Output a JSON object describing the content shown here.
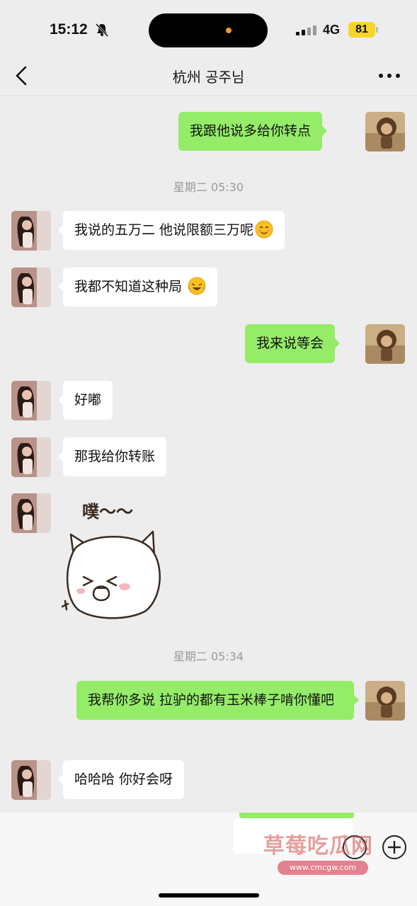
{
  "status_bar": {
    "time": "15:12",
    "network": "4G",
    "battery": "81"
  },
  "header": {
    "title": "杭州 공주님"
  },
  "messages": [
    {
      "side": "out",
      "text": "我跟他说多给你转点"
    },
    {
      "type": "time",
      "text": "星期二 05:30"
    },
    {
      "side": "in",
      "text": "我说的五万二 他说限额三万呢",
      "emoji": "smiling-face-icon"
    },
    {
      "side": "in",
      "text": "我都不知道这种局",
      "emoji": "crying-laughing-face-icon"
    },
    {
      "side": "out",
      "text": "我来说等会"
    },
    {
      "side": "in",
      "text": "好嘟"
    },
    {
      "side": "in",
      "text": "那我给你转账"
    },
    {
      "side": "in",
      "sticker": {
        "caption": "噗～～",
        "icon": "giggling-cat-sticker"
      }
    },
    {
      "type": "time",
      "text": "星期二 05:34"
    },
    {
      "side": "out",
      "text": "我帮你多说 拉驴的都有玉米棒子啃你懂吧"
    },
    {
      "side": "in",
      "text": "哈哈哈 你好会呀"
    }
  ],
  "watermark": {
    "text": "草莓吃瓜网",
    "url": "www.cmcgw.com"
  },
  "colors": {
    "background": "#ededed",
    "outgoing_bubble": "#95ec69",
    "incoming_bubble": "#ffffff",
    "battery": "#f6d528"
  }
}
